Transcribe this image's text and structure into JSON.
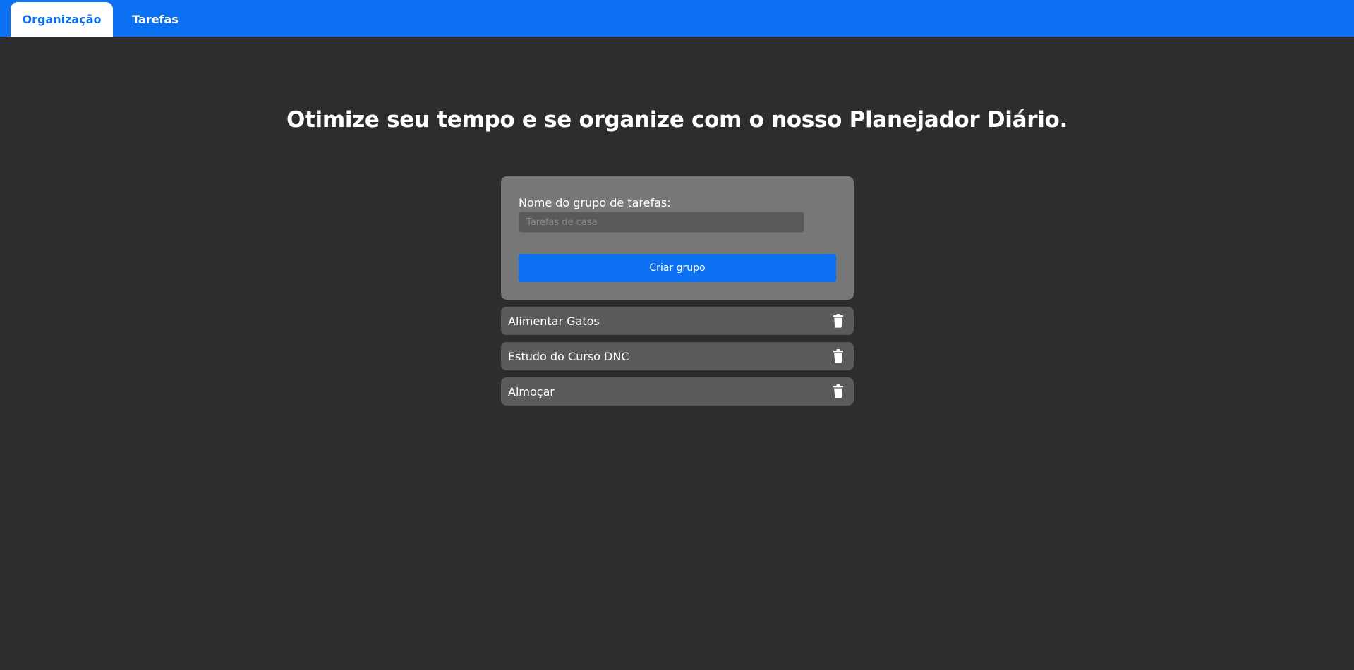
{
  "nav": {
    "tabs": [
      {
        "label": "Organização",
        "active": true
      },
      {
        "label": "Tarefas",
        "active": false
      }
    ]
  },
  "main": {
    "headline": "Otimize seu tempo e se organize com o nosso Planejador Diário."
  },
  "form": {
    "label": "Nome do grupo de tarefas:",
    "input_placeholder": "Tarefas de casa",
    "input_value": "",
    "submit_label": "Criar grupo"
  },
  "groups": [
    {
      "name": "Alimentar Gatos",
      "icon": "trash-icon"
    },
    {
      "name": "Estudo do Curso DNC",
      "icon": "trash-icon"
    },
    {
      "name": "Almoçar",
      "icon": "trash-icon"
    }
  ],
  "colors": {
    "accent": "#0c70f2",
    "background": "#2d2d2d",
    "card": "#777777",
    "item": "#5b5b5b"
  }
}
